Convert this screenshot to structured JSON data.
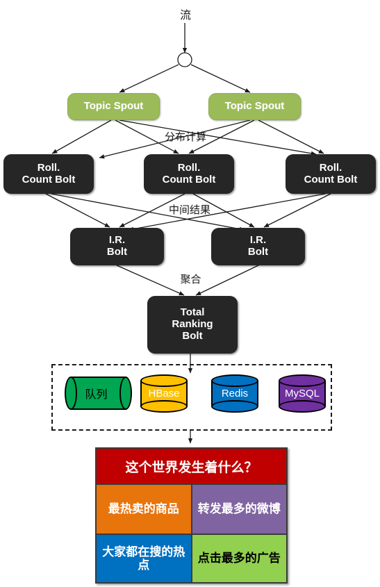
{
  "diagram": {
    "source_label": "流",
    "stage_labels": {
      "distribute": "分布计算",
      "intermediate": "中间结果",
      "aggregate": "聚合"
    },
    "spouts": [
      {
        "label": "Topic Spout"
      },
      {
        "label": "Topic Spout"
      }
    ],
    "count_bolts": [
      {
        "line1": "Roll.",
        "line2": "Count Bolt"
      },
      {
        "line1": "Roll.",
        "line2": "Count Bolt"
      },
      {
        "line1": "Roll.",
        "line2": "Count Bolt"
      }
    ],
    "ir_bolts": [
      {
        "line1": "I.R.",
        "line2": "Bolt"
      },
      {
        "line1": "I.R.",
        "line2": "Bolt"
      }
    ],
    "total_bolt": {
      "line1": "Total",
      "line2": "Ranking",
      "line3": "Bolt"
    },
    "storage": [
      {
        "label": "队列",
        "color": "#00A651",
        "text_color": "#000000",
        "shape": "horizontal-cylinder"
      },
      {
        "label": "HBase",
        "color": "#FFC000",
        "text_color": "#FFFFFF",
        "shape": "cylinder"
      },
      {
        "label": "Redis",
        "color": "#0070C0",
        "text_color": "#FFFFFF",
        "shape": "cylinder"
      },
      {
        "label": "MySQL",
        "color": "#7030A0",
        "text_color": "#FFFFFF",
        "shape": "cylinder"
      }
    ],
    "panel": {
      "header": {
        "label": "这个世界发生着什么？",
        "color": "#C00000",
        "text_color": "#FFFFFF"
      },
      "cells": [
        {
          "label": "最热卖的商品",
          "color": "#E8740C",
          "text_color": "#FFFFFF"
        },
        {
          "label": "转发最多的微博",
          "color": "#8064A2",
          "text_color": "#FFFFFF"
        },
        {
          "label": "大家都在搜的热点",
          "color": "#0070C0",
          "text_color": "#FFFFFF"
        },
        {
          "label": "点击最多的广告",
          "color": "#92D050",
          "text_color": "#000000"
        }
      ]
    },
    "colors": {
      "spout": "#9BBB59",
      "bolt": "#262626",
      "edge": "#1a1a1a"
    }
  }
}
